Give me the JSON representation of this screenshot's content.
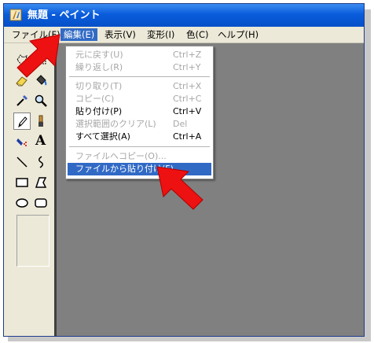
{
  "window": {
    "title": "無題 - ペイント"
  },
  "menubar": {
    "items": [
      {
        "label": "ファイル(F)"
      },
      {
        "label": "編集(E)"
      },
      {
        "label": "表示(V)"
      },
      {
        "label": "変形(I)"
      },
      {
        "label": "色(C)"
      },
      {
        "label": "ヘルプ(H)"
      }
    ]
  },
  "edit_menu": {
    "items": [
      {
        "label": "元に戻す(U)",
        "shortcut": "Ctrl+Z",
        "enabled": false
      },
      {
        "label": "繰り返し(R)",
        "shortcut": "Ctrl+Y",
        "enabled": false
      },
      {
        "label": "切り取り(T)",
        "shortcut": "Ctrl+X",
        "enabled": false
      },
      {
        "label": "コピー(C)",
        "shortcut": "Ctrl+C",
        "enabled": false
      },
      {
        "label": "貼り付け(P)",
        "shortcut": "Ctrl+V",
        "enabled": true
      },
      {
        "label": "選択範囲のクリア(L)",
        "shortcut": "Del",
        "enabled": false
      },
      {
        "label": "すべて選択(A)",
        "shortcut": "Ctrl+A",
        "enabled": true
      },
      {
        "label": "ファイルへコピー(O)...",
        "shortcut": "",
        "enabled": false
      },
      {
        "label": "ファイルから貼り付け(F)",
        "shortcut": "",
        "enabled": true,
        "highlighted": true
      }
    ]
  },
  "toolbox": {
    "tools": [
      "free-select-icon",
      "rect-select-icon",
      "eraser-icon",
      "fill-icon",
      "color-picker-icon",
      "magnifier-icon",
      "pencil-icon",
      "brush-icon",
      "airbrush-icon",
      "text-icon",
      "line-icon",
      "curve-icon",
      "rectangle-icon",
      "polygon-icon",
      "ellipse-icon",
      "rounded-rect-icon"
    ],
    "text_tool_glyph": "A"
  },
  "colors": {
    "highlight": "#316ac5",
    "arrow": "#ee1111",
    "titlebar": "#0a5cdc"
  }
}
